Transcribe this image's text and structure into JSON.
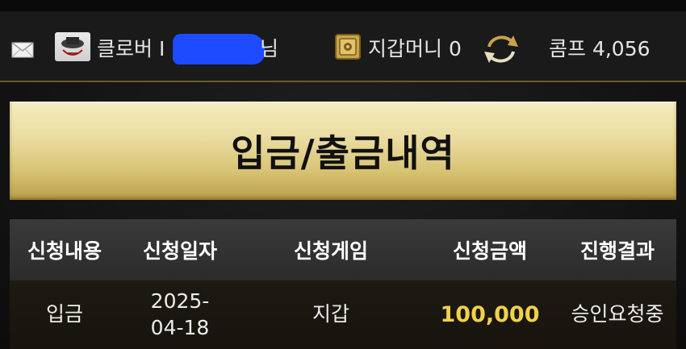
{
  "header": {
    "nickname_prefix": "클로버 I",
    "nickname_suffix": "님",
    "wallet_label": "지갑머니 0",
    "comp_label": "콤프 4,056",
    "icons": [
      "mail-icon",
      "avatar",
      "safe-icon",
      "refresh-icon"
    ]
  },
  "page_title": "입금/출금내역",
  "table": {
    "columns": [
      "신청내용",
      "신청일자",
      "신청게임",
      "신청금액",
      "진행결과"
    ],
    "rows": [
      {
        "type": "입금",
        "date": "2025-\n04-18",
        "game": "지갑",
        "amount": "100,000",
        "status": "승인요청중"
      }
    ]
  },
  "colors": {
    "accent_gold": "#e6d48f",
    "amount_yellow": "#f0d24a",
    "redaction_blue": "#1e4bff"
  }
}
